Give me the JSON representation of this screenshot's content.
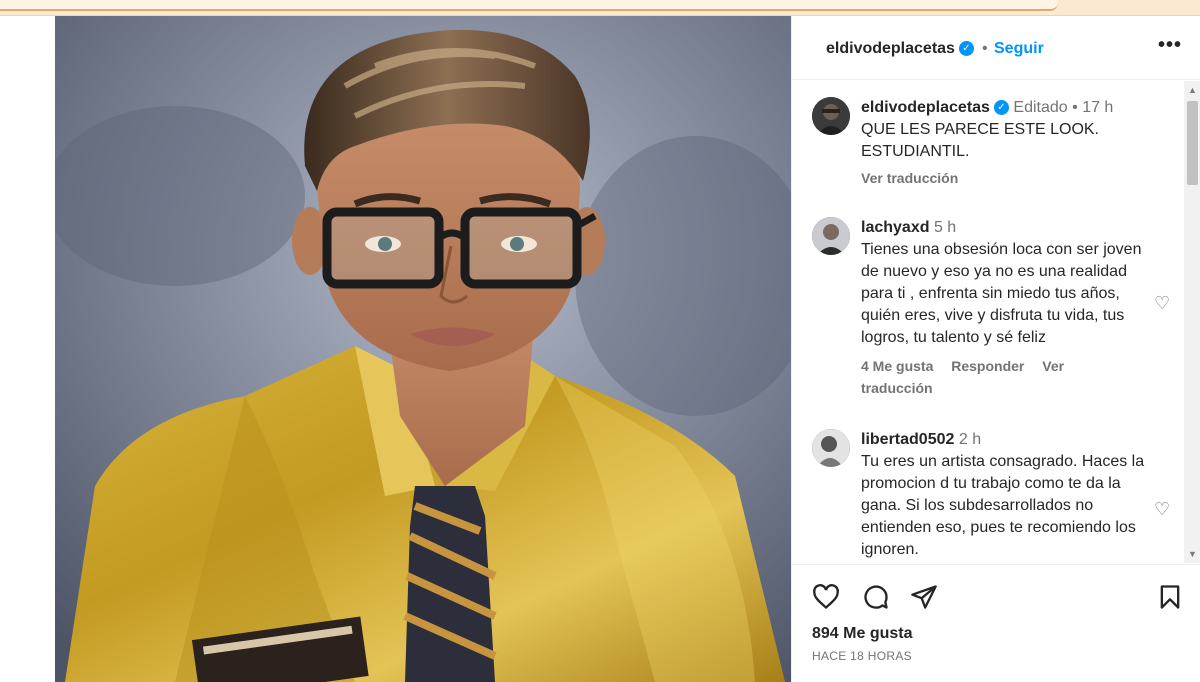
{
  "post": {
    "username": "eldivodeplacetas",
    "follow_label": "Seguir",
    "separator": "•",
    "more_label": "•••"
  },
  "caption": {
    "username": "eldivodeplacetas",
    "edited": "Editado",
    "sep": "•",
    "time": "17 h",
    "text_line1": "QUE LES PARECE ESTE LOOK.",
    "text_line2": "ESTUDIANTIL.",
    "translate": "Ver traducción"
  },
  "comments": [
    {
      "username": "lachyaxd",
      "time": "5 h",
      "text": "Tienes una obsesión loca con ser joven de nuevo y eso ya no es una realidad para ti , enfrenta sin miedo tus años, quién eres, vive y disfruta tu vida, tus logros, tu talento y sé feliz",
      "likes": "4 Me gusta",
      "reply": "Responder",
      "translate": "Ver traducción"
    },
    {
      "username": "libertad0502",
      "time": "2 h",
      "text": "Tu eres un artista consagrado. Haces la promocion d tu trabajo como te da la gana. Si los subdesarrollados no entienden eso, pues te recomiendo los ignoren."
    }
  ],
  "footer": {
    "likes": "894 Me gusta",
    "time": "HACE 18 HORAS"
  },
  "icons": {
    "verified": "verified-badge-icon",
    "heart": "heart-icon",
    "comment": "comment-icon",
    "share": "share-icon",
    "save": "bookmark-icon"
  },
  "colors": {
    "accent": "#0095f6",
    "text": "#262626",
    "muted": "#737373"
  }
}
